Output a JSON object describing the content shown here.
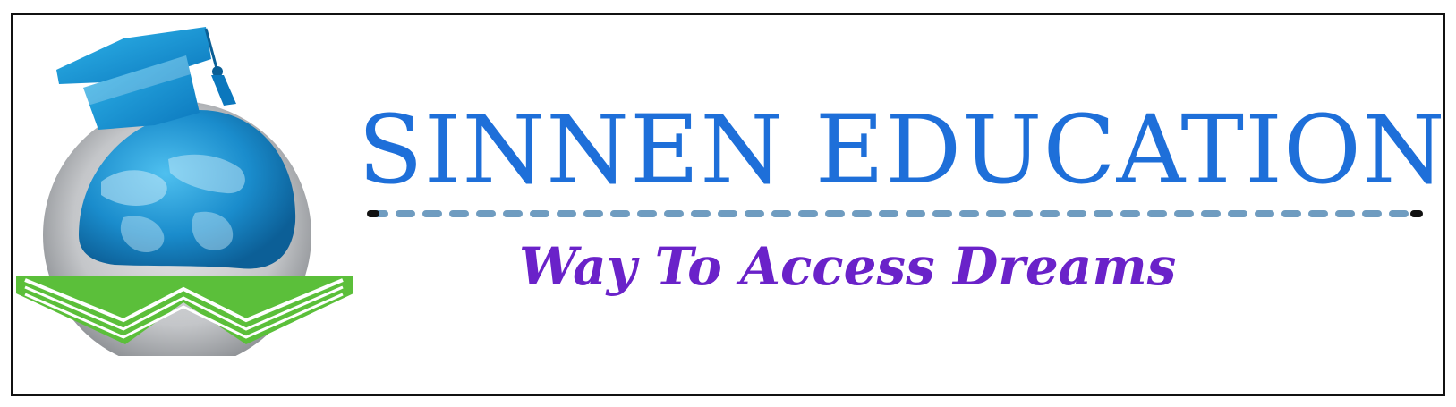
{
  "brand": {
    "name": "SINNEN EDUCATION",
    "tagline": "Way To Access Dreams",
    "colors": {
      "title": "#1e6fd9",
      "tagline": "#6a22c9",
      "divider": "#6f9cc0",
      "cap": "#0a9ad8",
      "globe_ocean": "#1a8ccc",
      "globe_rim": "#b5b7ba",
      "book": "#5bbf3a"
    },
    "icons": [
      "graduation-cap-icon",
      "globe-icon",
      "open-book-icon"
    ]
  }
}
